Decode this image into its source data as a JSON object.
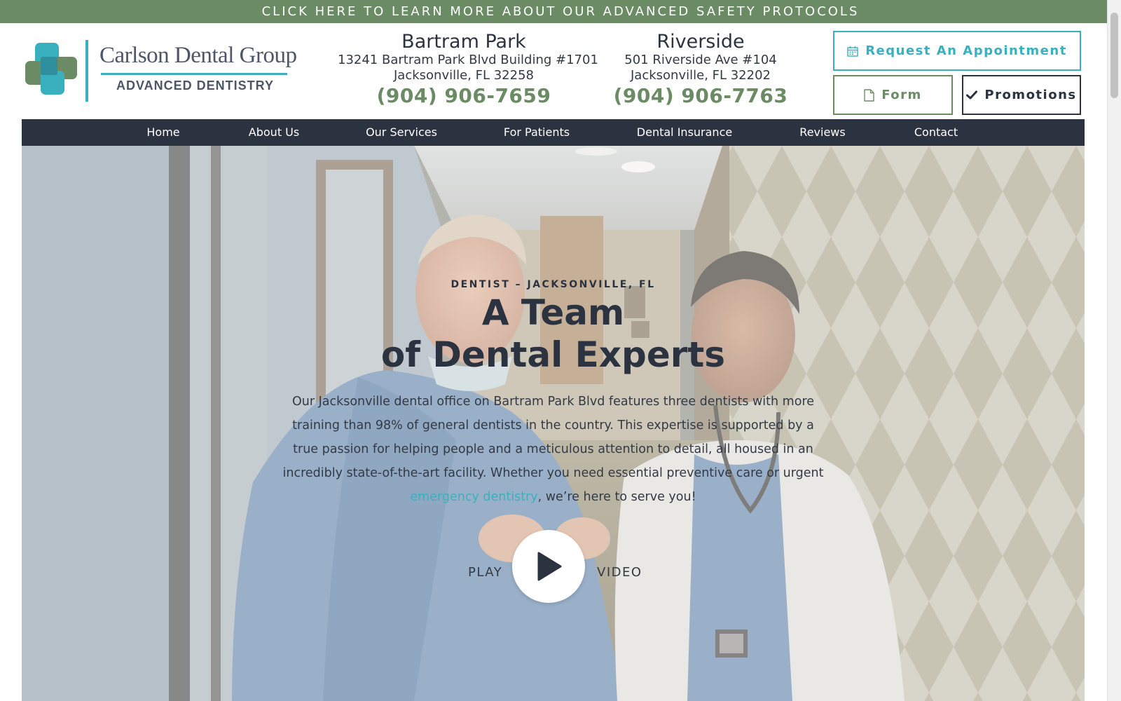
{
  "banner": {
    "text": "CLICK HERE TO LEARN MORE ABOUT OUR ADVANCED SAFETY PROTOCOLS"
  },
  "logo": {
    "name": "Carlson Dental Group",
    "tagline": "ADVANCED DENTISTRY"
  },
  "locations": [
    {
      "name": "Bartram Park",
      "address_line1": "13241 Bartram Park Blvd Building #1701",
      "address_line2": "Jacksonville, FL 32258",
      "phone": "(904) 906-7659"
    },
    {
      "name": "Riverside",
      "address_line1": "501 Riverside Ave #104",
      "address_line2": "Jacksonville, FL 32202",
      "phone": "(904) 906-7763"
    }
  ],
  "buttons": {
    "appointment": "Request An Appointment",
    "form": "Form",
    "promotions": "Promotions"
  },
  "nav": {
    "items": [
      "Home",
      "About Us",
      "Our Services",
      "For Patients",
      "Dental Insurance",
      "Reviews",
      "Contact"
    ]
  },
  "hero": {
    "kicker": "DENTIST – JACKSONVILLE, FL",
    "title_line1": "A Team",
    "title_line2": "of Dental Experts",
    "text_before_link": "Our Jacksonville dental office on Bartram Park Blvd features three dentists with more training than 98% of general dentists in the country. This expertise is supported by a true passion for helping people and a meticulous attention to detail, all housed in an incredibly state-of-the-art facility. Whether you need essential preventive care or urgent ",
    "link_text": "emergency dentistry",
    "text_after_link": ", we’re here to serve you!",
    "play_left": "PLAY",
    "play_right": "VIDEO"
  },
  "colors": {
    "green": "#6a8b63",
    "teal": "#3ab0bf",
    "navy": "#2c3340",
    "text": "#333a44"
  },
  "icons": {
    "appointment": "calendar-icon",
    "form": "document-icon",
    "promotions": "checkmark-icon",
    "video": "play-icon"
  }
}
